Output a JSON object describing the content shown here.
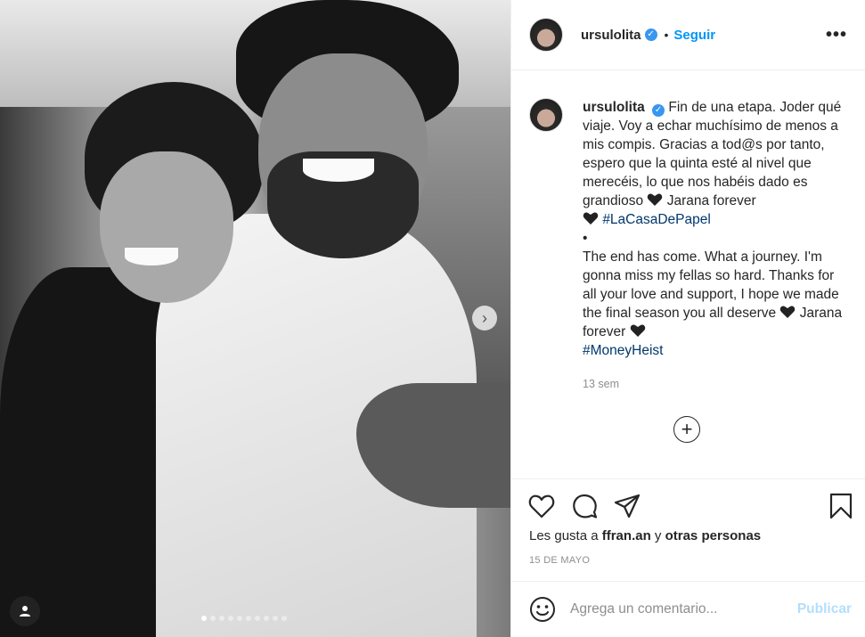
{
  "post": {
    "username": "ursulolita",
    "follow_label": "Seguir",
    "separator": "•",
    "more_label": "•••",
    "verified_mark": "✓",
    "caption_intro": "Fin de una etapa. Joder qué viaje. Voy a echar muchísimo de menos a mis compis. Gracias a tod@s por tanto, espero que la quinta esté al nivel que merecéis, lo que nos habéis dado es grandioso ",
    "caption_jarana_es": " Jarana forever",
    "hashtag_es": "#LaCasaDePapel",
    "bullet": "•",
    "caption_en": "The end has come. What a journey. I'm gonna miss my fellas so hard. Thanks for all your love and support, I hope we made the final season you all deserve ",
    "caption_jarana_en": " Jarana forever ",
    "hashtag_en": "#MoneyHeist",
    "time_ago": "13 sem",
    "load_more": "+",
    "next_glyph": "›"
  },
  "likes": {
    "prefix": "Les gusta a ",
    "user": "ffran.an",
    "conjunction": " y ",
    "others": "otras personas"
  },
  "date": "15 DE MAYO",
  "composer": {
    "placeholder": "Agrega un comentario...",
    "publish_label": "Publicar"
  },
  "carousel": {
    "slide_count": 10,
    "active_index": 0
  },
  "icons": {
    "like": "heart-icon",
    "comment": "comment-icon",
    "share": "paper-plane-icon",
    "save": "bookmark-icon",
    "emoji": "smiley-icon",
    "verified": "verified-badge-icon",
    "more": "more-options-icon",
    "add": "plus-circle-icon",
    "next": "chevron-right-icon",
    "tag": "user-tag-icon"
  },
  "colors": {
    "link_blue": "#0095f6",
    "hashtag": "#00376b",
    "muted": "#8e8e8e",
    "publish_disabled": "#b2dffc",
    "verified": "#3897f0"
  }
}
